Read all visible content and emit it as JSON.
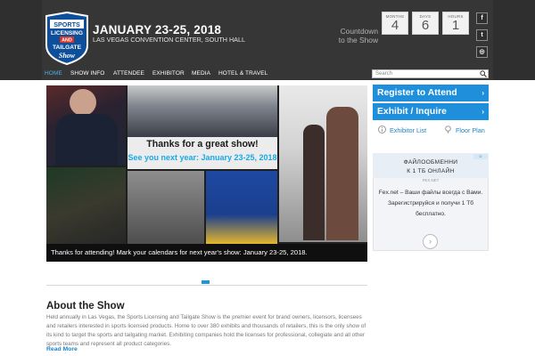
{
  "header": {
    "logo": {
      "line1": "SPORTS",
      "line2": "LICENSING",
      "line3": "AND",
      "line4": "TAILGATE",
      "line5": "Show"
    },
    "event_date": "JANUARY 23-25, 2018",
    "venue": "LAS VEGAS CONVENTION CENTER, SOUTH HALL",
    "countdown_label_1": "Countdown",
    "countdown_label_2": "to the Show",
    "countdown": [
      {
        "unit": "MONTHS",
        "value": "4"
      },
      {
        "unit": "DAYS",
        "value": "6"
      },
      {
        "unit": "HOURS",
        "value": "1"
      }
    ],
    "social": [
      {
        "label": "f",
        "icon": "facebook-icon"
      },
      {
        "label": "t",
        "icon": "twitter-icon"
      },
      {
        "label": "◎",
        "icon": "instagram-icon"
      }
    ]
  },
  "nav": {
    "items": [
      "HOME",
      "SHOW INFO",
      "ATTENDEE",
      "EXHIBITOR",
      "MEDIA",
      "HOTEL & TRAVEL"
    ],
    "search_placeholder": "Search"
  },
  "slider": {
    "panel_title": "Thanks for a great show!",
    "panel_subtitle": "See you next year: January 23-25, 2018",
    "caption": "Thanks for attending! Mark your calendars for next year's show: January 23-25, 2018."
  },
  "about": {
    "title": "About the Show",
    "text": "Held annually in Las Vegas, the Sports Licensing and Tailgate Show is the premier event for brand owners, licensors, licensees and retailers interested in sports licensed products. Home to over 380 exhibits and thousands of retailers, this is the only show of its kind to target the sports and tailgating market. Exhibiting companies hold the licenses for professional, collegiate and all other sports teams and represent all product categories.",
    "read_more": "Read More"
  },
  "sidebar": {
    "register_label": "Register to Attend",
    "exhibit_label": "Exhibit / Inquire",
    "exhibitor_list_label": "Exhibitor List",
    "floor_plan_label": "Floor Plan"
  },
  "ad": {
    "title_line1": "ФАЙЛООБМЕННИ",
    "title_line2": "К 1 ТБ ОНЛАЙН",
    "source": "FEX.NET",
    "body": "Fex.net – Ваши файлы всегда с Вами. Зарегистрируйся и получи 1 Тб бесплатно.",
    "badge": "D"
  },
  "colors": {
    "header_bg": "#363636",
    "accent_blue": "#1f8fdb",
    "nav_active": "#4db2ea",
    "link": "#1e84c7"
  }
}
